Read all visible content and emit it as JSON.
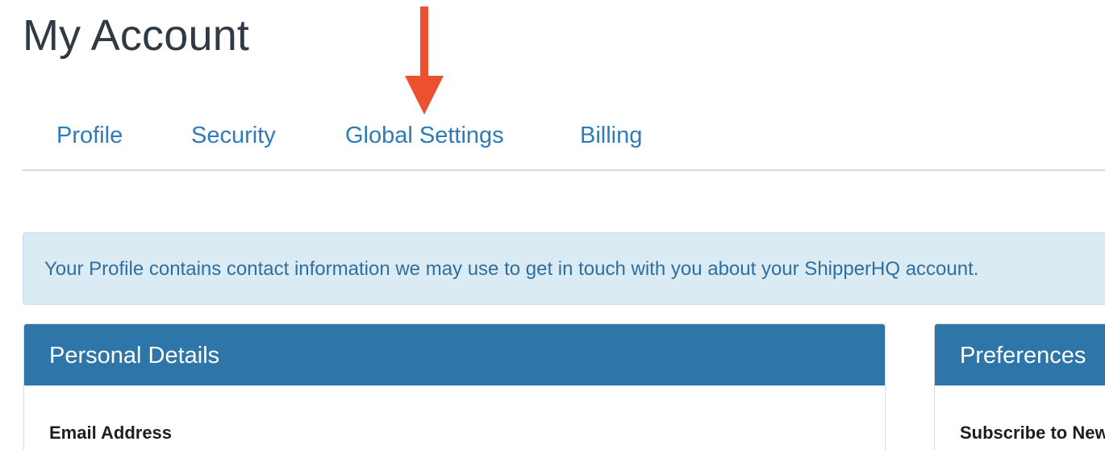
{
  "page": {
    "title": "My Account"
  },
  "tabs": [
    {
      "label": "Profile"
    },
    {
      "label": "Security"
    },
    {
      "label": "Global Settings"
    },
    {
      "label": "Billing"
    }
  ],
  "alert": {
    "text": "Your Profile contains contact information we may use to get in touch with you about your ShipperHQ account."
  },
  "panels": {
    "personal_details": {
      "title": "Personal Details",
      "field_label": "Email Address"
    },
    "preferences": {
      "title": "Preferences",
      "field_label": "Subscribe to Newsletter"
    }
  },
  "colors": {
    "accent": "#2f7ab9",
    "panel_header": "#2e76aa",
    "annotation_arrow": "#eb5130",
    "alert_background": "#dbebf4"
  },
  "icons": {
    "annotation": "down-arrow-icon"
  }
}
